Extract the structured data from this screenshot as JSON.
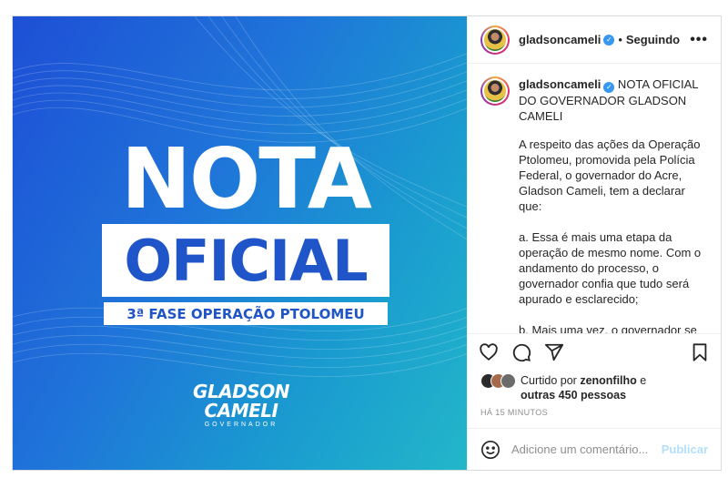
{
  "post": {
    "image": {
      "headline_line1": "NOTA",
      "headline_line2": "OFICIAL",
      "subtitle": "3ª FASE OPERAÇÃO PTOLOMEU",
      "signature_line1": "GLADSON",
      "signature_line2": "CAMELI",
      "signature_role": "GOVERNADOR"
    },
    "header": {
      "username": "gladsoncameli",
      "verified_mark": "✓",
      "separator": "•",
      "follow_status": "Seguindo",
      "more": "•••"
    },
    "caption": {
      "username": "gladsoncameli",
      "title": " NOTA OFICIAL DO GOVERNADOR GLADSON CAMELI",
      "paragraph1": "A respeito das ações da Operação Ptolomeu, promovida pela Polícia Federal, o governador do Acre, Gladson Cameli, tem a declarar que:",
      "paragraph2": "a. Essa é mais uma etapa da operação de mesmo nome. Com o andamento do processo, o governador confia que tudo será apurado e esclarecido;",
      "paragraph3": "b. Mais uma vez, o governador se coloca à disposição das autoridades, colaborando com mais essa etapa das investigações;"
    },
    "actions": {
      "icons": [
        "heart-icon",
        "comment-icon",
        "share-icon",
        "bookmark-icon"
      ]
    },
    "likes": {
      "prefix": "Curtido por ",
      "user": "zenonfilho",
      "middle": " e",
      "others": "outras 450 pessoas"
    },
    "timestamp": "HÁ 15 MINUTOS",
    "comment": {
      "placeholder": "Adicione um comentário...",
      "publish": "Publicar"
    }
  },
  "colors": {
    "verified": "#3897f0",
    "publish_disabled": "#b2dffc",
    "image_blue": "#1f55c8"
  }
}
